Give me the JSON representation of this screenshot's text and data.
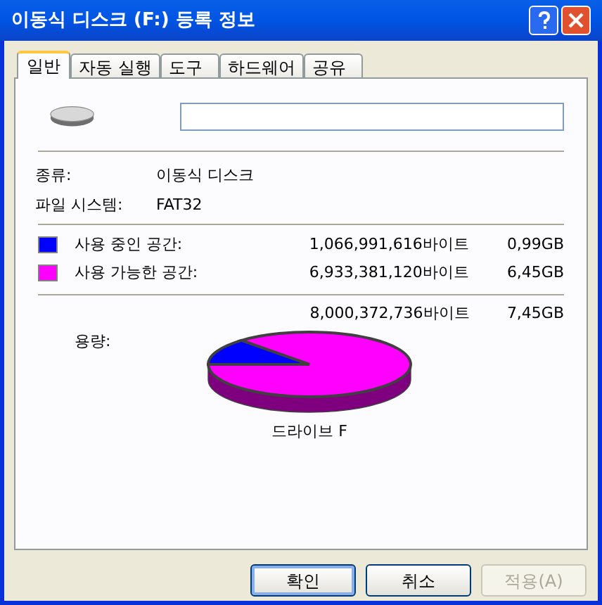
{
  "window": {
    "title": "이동식 디스크 (F:) 등록 정보"
  },
  "tabs": [
    {
      "label": "일반",
      "selected": true
    },
    {
      "label": "자동 실행",
      "selected": false
    },
    {
      "label": "도구",
      "selected": false
    },
    {
      "label": "하드웨어",
      "selected": false
    },
    {
      "label": "공유",
      "selected": false
    }
  ],
  "info": [
    {
      "label": "종류:",
      "value": "이동식 디스크"
    },
    {
      "label": "파일 시스템:",
      "value": "FAT32"
    }
  ],
  "space": [
    {
      "label": "사용 중인 공간:",
      "bytes": "1,066,991,616바이트",
      "size": "0,99GB",
      "color": "#0000ff"
    },
    {
      "label": "사용 가능한 공간:",
      "bytes": "6,933,381,120바이트",
      "size": "6,45GB",
      "color": "#ff00ff"
    }
  ],
  "capacity": {
    "label": "용량:",
    "bytes": "8,000,372,736바이트",
    "size": "7,45GB"
  },
  "pie": {
    "caption": "드라이브 F"
  },
  "buttons": [
    {
      "label": "확인",
      "disabled": false,
      "default": true
    },
    {
      "label": "취소",
      "disabled": false,
      "default": false
    },
    {
      "label": "적용(A)",
      "disabled": true,
      "default": false
    }
  ]
}
